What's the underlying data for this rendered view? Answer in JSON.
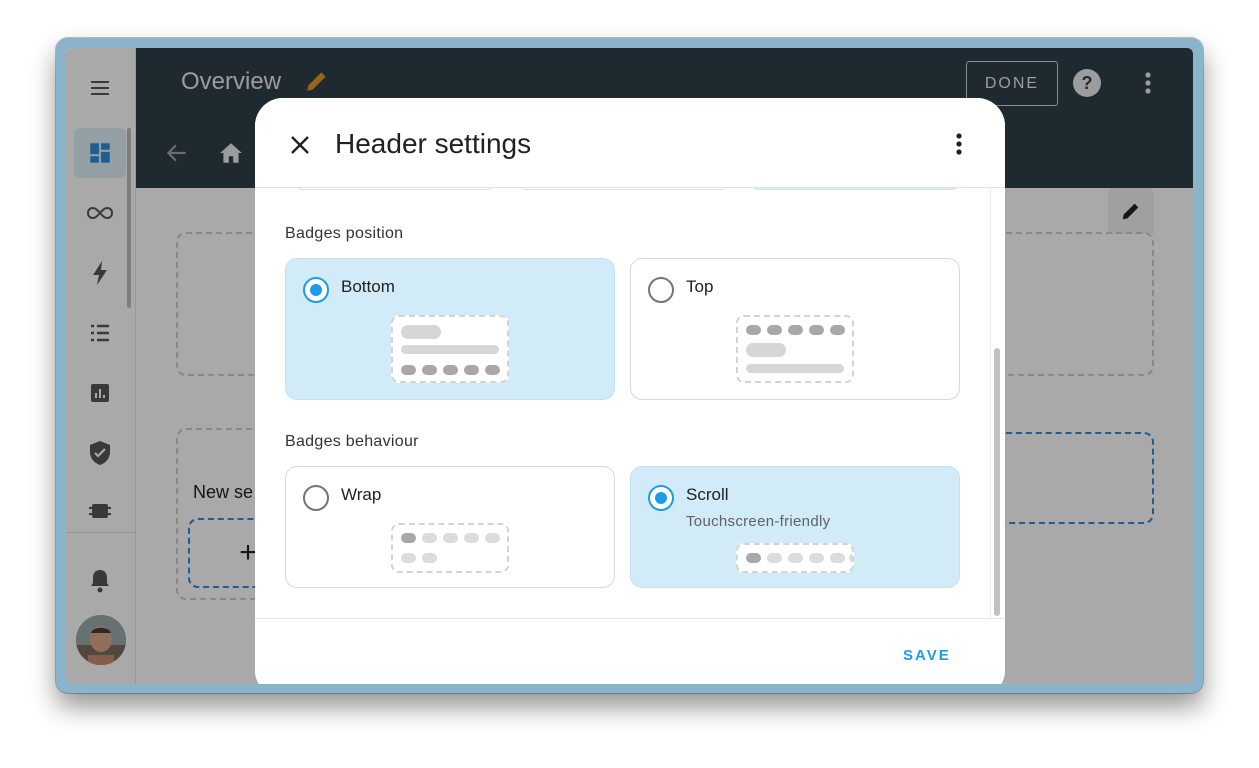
{
  "app": {
    "title": "Overview",
    "done_label": "DONE"
  },
  "sidebar": {
    "items": [
      {
        "icon": "dashboard-icon",
        "active": true
      },
      {
        "icon": "infinity-icon",
        "active": false
      },
      {
        "icon": "lightning-icon",
        "active": false
      },
      {
        "icon": "list-icon",
        "active": false
      },
      {
        "icon": "chart-icon",
        "active": false
      },
      {
        "icon": "shield-check-icon",
        "active": false
      },
      {
        "icon": "chip-icon",
        "active": false
      }
    ],
    "bottom": [
      {
        "icon": "bell-icon"
      },
      {
        "icon": "avatar"
      }
    ]
  },
  "dashboard": {
    "new_section_label": "New se",
    "add_label": "+"
  },
  "dialog": {
    "title": "Header settings",
    "sections": [
      {
        "label": "Badges position",
        "options": [
          {
            "label": "Bottom",
            "selected": true
          },
          {
            "label": "Top",
            "selected": false
          }
        ]
      },
      {
        "label": "Badges behaviour",
        "options": [
          {
            "label": "Wrap",
            "selected": false
          },
          {
            "label": "Scroll",
            "subtitle": "Touchscreen-friendly",
            "selected": true
          }
        ]
      }
    ],
    "save_label": "SAVE"
  },
  "colors": {
    "accent": "#1e9be8",
    "selected_bg": "#d2ebf8",
    "appbar": "#2e3e47"
  }
}
